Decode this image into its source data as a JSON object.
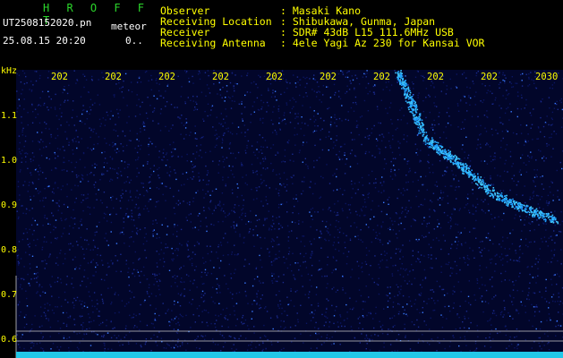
{
  "app": {
    "title": "H R O F F T",
    "filename": "UT2508152020.pn",
    "tag": "meteor",
    "datetime": "25.08.15 20:20",
    "counter": "0.."
  },
  "info": {
    "rows": [
      {
        "label": "Observer",
        "value": ": Masaki Kano"
      },
      {
        "label": "Receiving Location",
        "value": ": Shibukawa, Gunma, Japan"
      },
      {
        "label": "Receiver",
        "value": ": SDR# 43dB L15 111.6MHz USB"
      },
      {
        "label": "Receiving Antenna",
        "value": ": 4ele Yagi Az 230 for Kansai VOR"
      }
    ]
  },
  "spectrogram": {
    "unit": "kHz",
    "y_ticks": [
      "1.1",
      "1.0",
      "0.9",
      "0.8",
      "0.7",
      "0.6"
    ],
    "time_ticks": [
      "202",
      "202",
      "202",
      "202",
      "202",
      "202",
      "202",
      "202",
      "202",
      "2030"
    ],
    "colors": {
      "background": "#000000",
      "noise": "#1a2a8c",
      "signal": "#40c8ff",
      "labels": "#ffff00",
      "title": "#2bd62b"
    }
  }
}
